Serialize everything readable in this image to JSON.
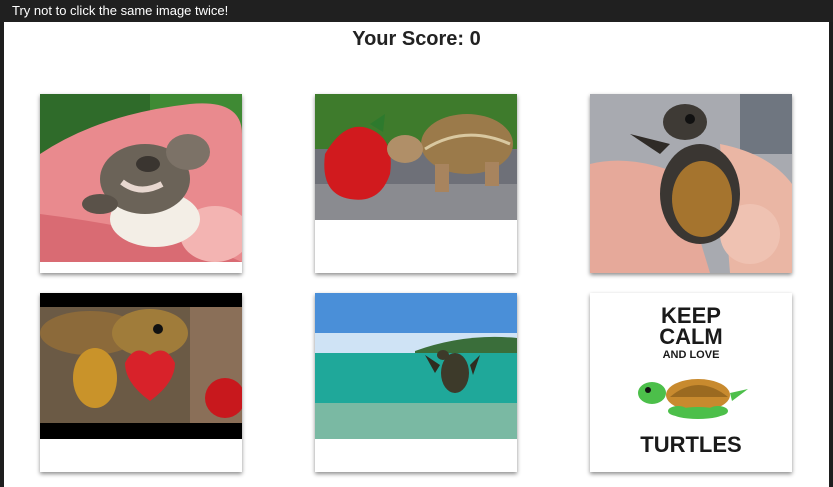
{
  "app": {
    "banner": "Try not to click the same image twice!",
    "score_label": "Your Score: 0"
  },
  "cards": [
    {
      "name": "hatchling-in-egg-image"
    },
    {
      "name": "tortoise-eating-strawberry-image"
    },
    {
      "name": "baby-turtle-in-hand-image"
    },
    {
      "name": "turtle-with-heart-strawberry-image"
    },
    {
      "name": "sea-turtle-underwater-image"
    },
    {
      "name": "keep-calm-love-turtles-image",
      "lines": [
        "KEEP",
        "CALM",
        "AND LOVE",
        "TURTLES"
      ]
    }
  ],
  "colors": {
    "text": "#222222",
    "keep_calm_text": "#1a1a1a",
    "turtle_green": "#4cbf4a",
    "turtle_shell": "#c88a2e"
  }
}
